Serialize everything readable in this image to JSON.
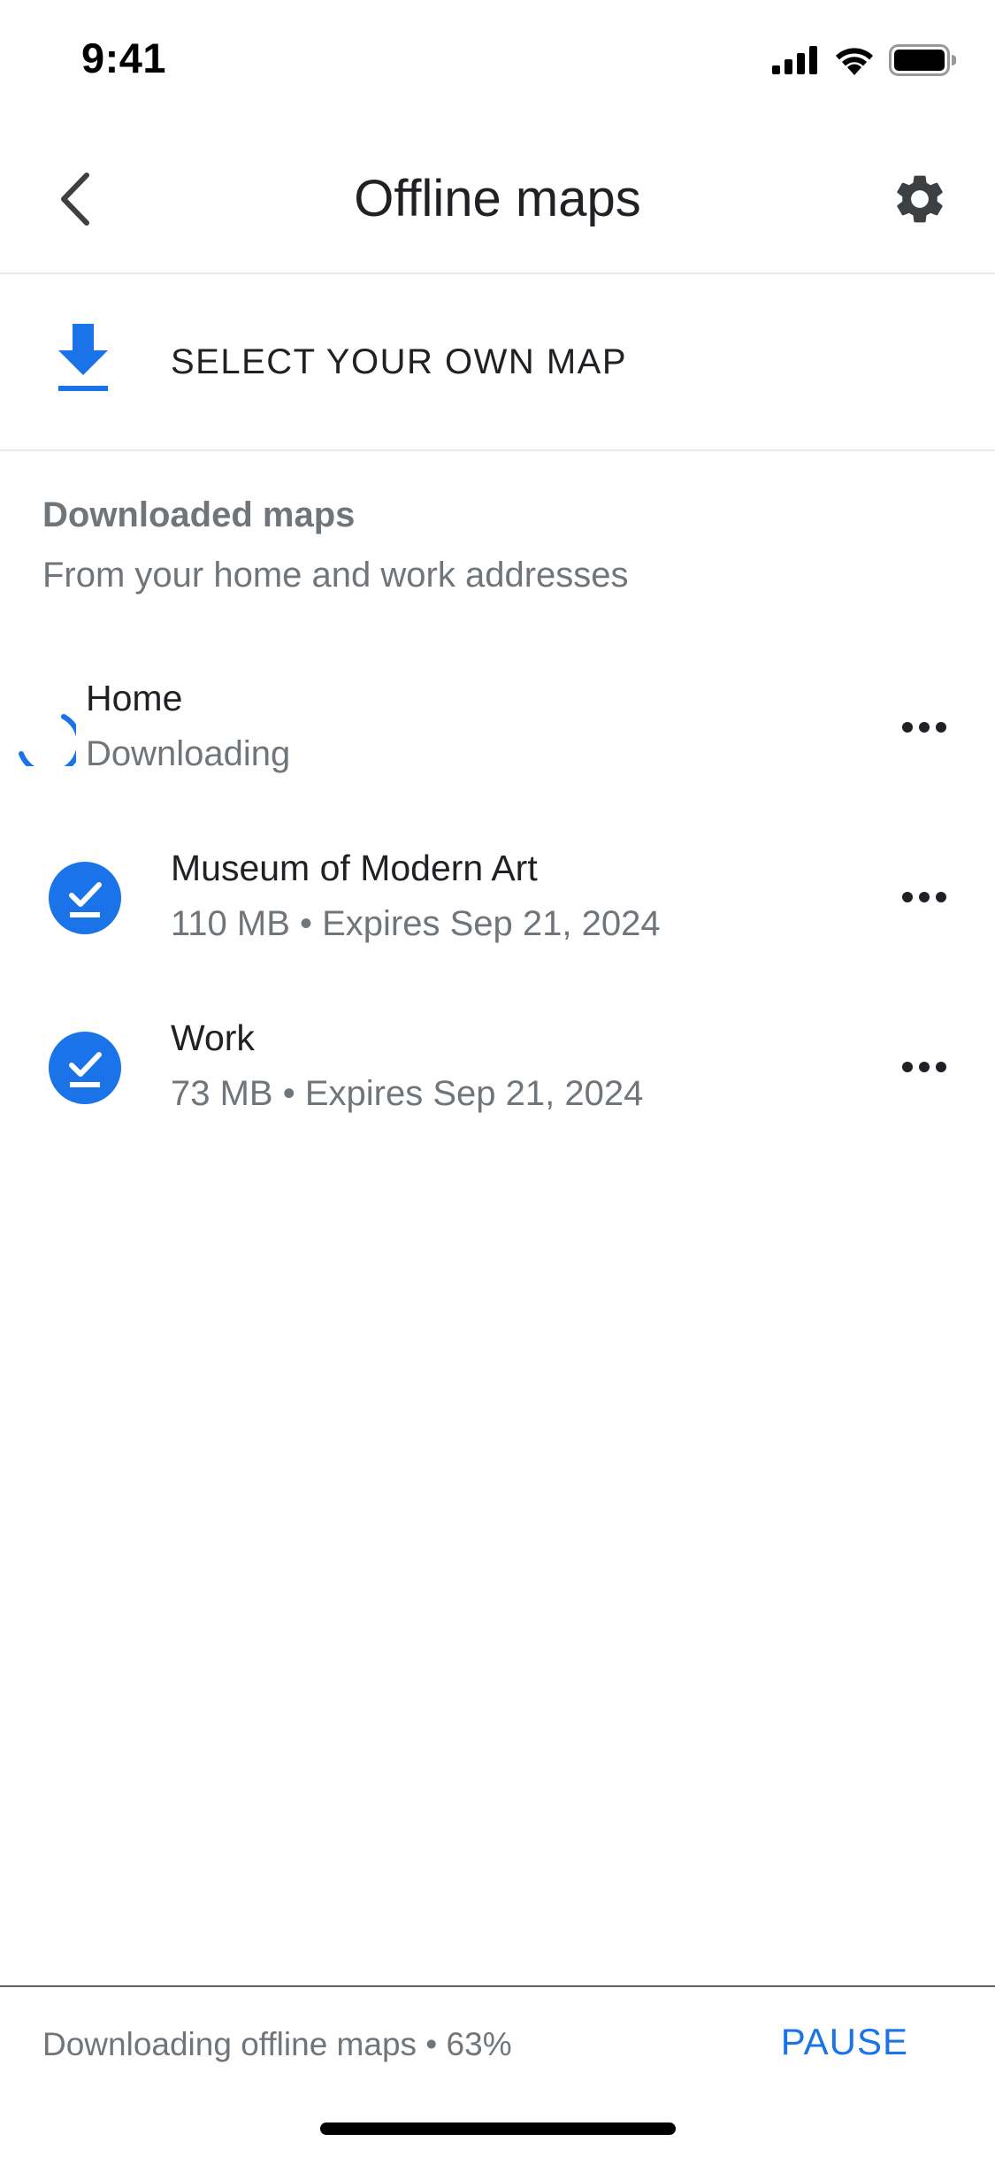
{
  "status_bar": {
    "time": "9:41"
  },
  "app_bar": {
    "title": "Offline maps",
    "back_icon": "chevron-left-icon",
    "settings_icon": "gear-icon"
  },
  "select_own_map": {
    "label": "SELECT YOUR OWN MAP",
    "icon": "download-icon"
  },
  "downloaded_section": {
    "title": "Downloaded maps",
    "subtitle": "From your home and work addresses"
  },
  "maps": [
    {
      "title": "Home",
      "subtitle": "Downloading",
      "state_icon": "loading-spinner-icon"
    },
    {
      "title": "Museum of Modern Art",
      "subtitle": "110 MB • Expires Sep 21, 2024",
      "state_icon": "downloaded-check-icon"
    },
    {
      "title": "Work",
      "subtitle": "73 MB • Expires Sep 21, 2024",
      "state_icon": "downloaded-check-icon"
    }
  ],
  "bottom_bar": {
    "status": "Downloading offline maps • 63%",
    "pause_label": "PAUSE"
  },
  "colors": {
    "accent": "#1a73e8",
    "secondary_text": "#70757a",
    "primary_text": "#202124"
  }
}
